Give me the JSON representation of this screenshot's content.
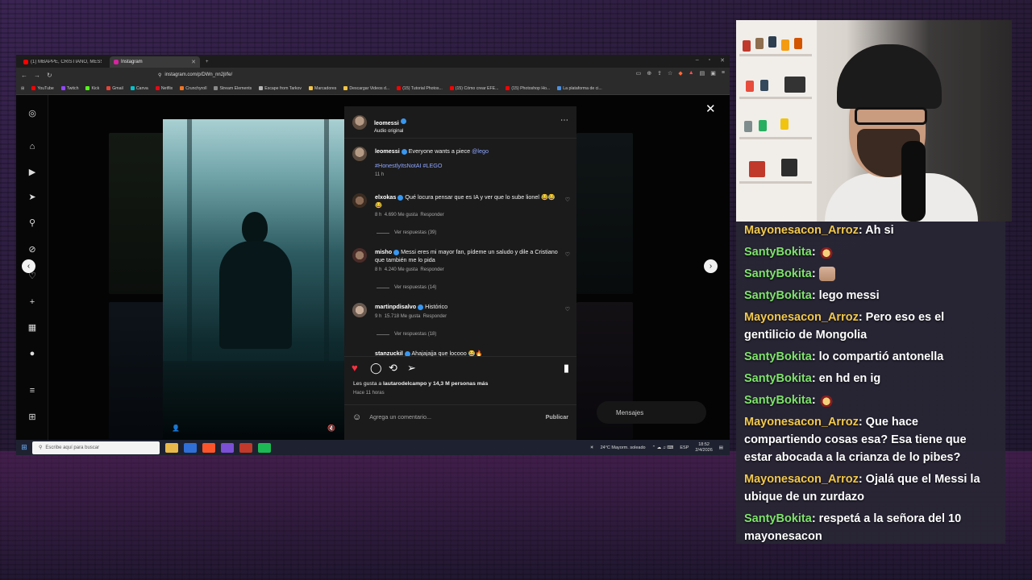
{
  "browser": {
    "tabs": [
      {
        "label": "(1) MBAPPÉ, CRISTIANO, MESSI Y VI...",
        "color": "#ff0000"
      },
      {
        "label": "Instagram",
        "color": "#d6249f"
      }
    ],
    "url": "instagram.com/p/DWn_nn2jl/fe/",
    "bookmarks": [
      {
        "label": "YouTube",
        "color": "#ff0000"
      },
      {
        "label": "Twitch",
        "color": "#9146ff"
      },
      {
        "label": "Kick",
        "color": "#53fc18"
      },
      {
        "label": "Gmail",
        "color": "#ea4335"
      },
      {
        "label": "Canva",
        "color": "#00c4cc"
      },
      {
        "label": "Netflix",
        "color": "#e50914"
      },
      {
        "label": "Crunchyroll",
        "color": "#f47521"
      },
      {
        "label": "Stream Elements",
        "color": "#8a8a8a"
      },
      {
        "label": "Escape from Tarkov",
        "color": "#b5b5b5"
      },
      {
        "label": "Marcadores",
        "color": "#f5c542"
      },
      {
        "label": "Descargar Videos d...",
        "color": "#f5c542"
      },
      {
        "label": "(15) Tutorial Photos...",
        "color": "#ff0000"
      },
      {
        "label": "(15) Cómo crear EFE...",
        "color": "#ff0000"
      },
      {
        "label": "(15) Photoshop Ho...",
        "color": "#ff0000"
      },
      {
        "label": "La plataforma de ci...",
        "color": "#4a90e2"
      }
    ]
  },
  "post": {
    "author": "leomessi",
    "audio": "Audio original",
    "caption_author": "leomessi",
    "caption": "Everyone wants a piece",
    "caption_mention": "@lego",
    "hashtags": "#HonestlyItsNotAI #LEGO",
    "caption_time": "11 h",
    "comments": [
      {
        "user": "elxokas",
        "text": "Qué locura pensar que es IA y ver que lo sube lionel 😂😂😂",
        "time": "8 h",
        "likes": "4.690 Me gusta",
        "reply": "Responder",
        "replies": "Ver respuestas (39)"
      },
      {
        "user": "misho",
        "text": "Messi eres mi mayor fan, pídeme un saludo y dile a Cristiano que también me lo pida",
        "time": "8 h",
        "likes": "4.240 Me gusta",
        "reply": "Responder",
        "replies": "Ver respuestas (14)"
      },
      {
        "user": "martinpdisalvo",
        "text": "Histórico",
        "time": "9 h",
        "likes": "15.718 Me gusta",
        "reply": "Responder",
        "replies": "Ver respuestas (18)"
      },
      {
        "user": "stanzuckil",
        "text": "Ahajajajja que locooo 😂🔥",
        "time": "",
        "likes": "",
        "reply": "",
        "replies": ""
      }
    ],
    "liked_by_prefix": "Les gusta a ",
    "liked_by_user": "lautarodelcampo",
    "liked_by_suffix": " y 14,3 M personas más",
    "posted": "Hace 11 horas",
    "comment_placeholder": "Agrega un comentario...",
    "publish": "Publicar"
  },
  "background": {
    "messages": "Mensajes"
  },
  "taskbar": {
    "search": "Escribe aquí para buscar",
    "weather": "24°C Mayorm. soleado",
    "lang": "ESP",
    "time": "18:52",
    "date": "2/4/2026"
  },
  "chat": [
    {
      "user": "Mayonesacon_Arroz",
      "color": "#f2c94c",
      "text": ": Ah si"
    },
    {
      "user": "SantyBokita",
      "color": "#7ee36b",
      "text": ": ",
      "emote": "cat"
    },
    {
      "user": "SantyBokita",
      "color": "#7ee36b",
      "text": ": ",
      "emote": "face"
    },
    {
      "user": "SantyBokita",
      "color": "#7ee36b",
      "text": ": lego messi"
    },
    {
      "user": "Mayonesacon_Arroz",
      "color": "#f2c94c",
      "text": ": Pero eso es el gentilicio de Mongolia"
    },
    {
      "user": "SantyBokita",
      "color": "#7ee36b",
      "text": ": lo compartió antonella"
    },
    {
      "user": "SantyBokita",
      "color": "#7ee36b",
      "text": ": en hd en ig"
    },
    {
      "user": "SantyBokita",
      "color": "#7ee36b",
      "text": ": ",
      "emote": "cat"
    },
    {
      "user": "Mayonesacon_Arroz",
      "color": "#f2c94c",
      "text": ": Que hace compartiendo cosas esa? Esa tiene que estar abocada a la crianza de lo pibes?"
    },
    {
      "user": "Mayonesacon_Arroz",
      "color": "#f2c94c",
      "text": ": Ojalá que el Messi la ubique de un zurdazo"
    },
    {
      "user": "SantyBokita",
      "color": "#7ee36b",
      "text": ": respetá a la señora del 10 mayonesacon"
    }
  ]
}
